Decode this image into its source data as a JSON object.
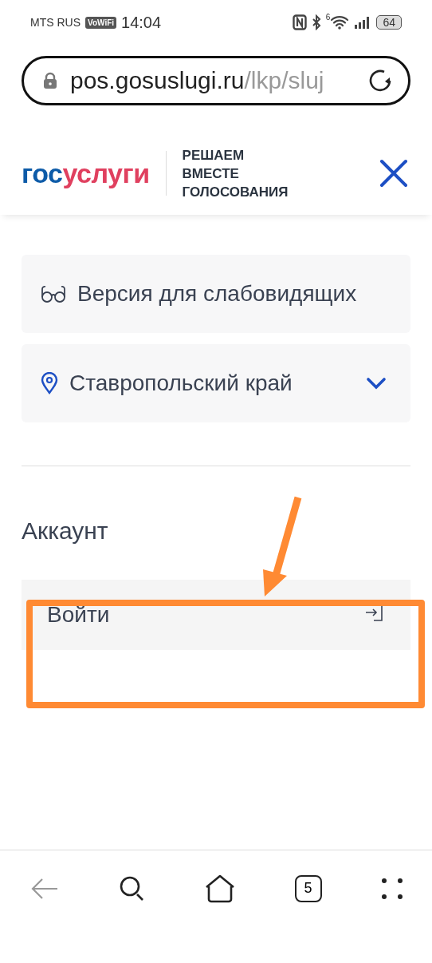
{
  "status_bar": {
    "carrier": "MTS RUS",
    "vowifi": "VoWiFi",
    "time": "14:04",
    "wifi_label": "6",
    "battery": "64"
  },
  "address_bar": {
    "host": "pos.gosuslugi.ru",
    "path": "/lkp/sluj"
  },
  "header": {
    "logo_part_1": "гос",
    "logo_part_2": "услуги",
    "tagline": [
      "РЕШАЕМ",
      "ВМЕСТЕ",
      "ГОЛОСОВАНИЯ"
    ]
  },
  "menu": [
    {
      "kind": "accessibility",
      "label": "Версия для слабовидящих"
    },
    {
      "kind": "region",
      "label": "Ставропольский край",
      "expanded": false
    }
  ],
  "account": {
    "title": "Аккаунт",
    "login": "Войти"
  },
  "bottom_nav": {
    "tabs_count": "5"
  }
}
